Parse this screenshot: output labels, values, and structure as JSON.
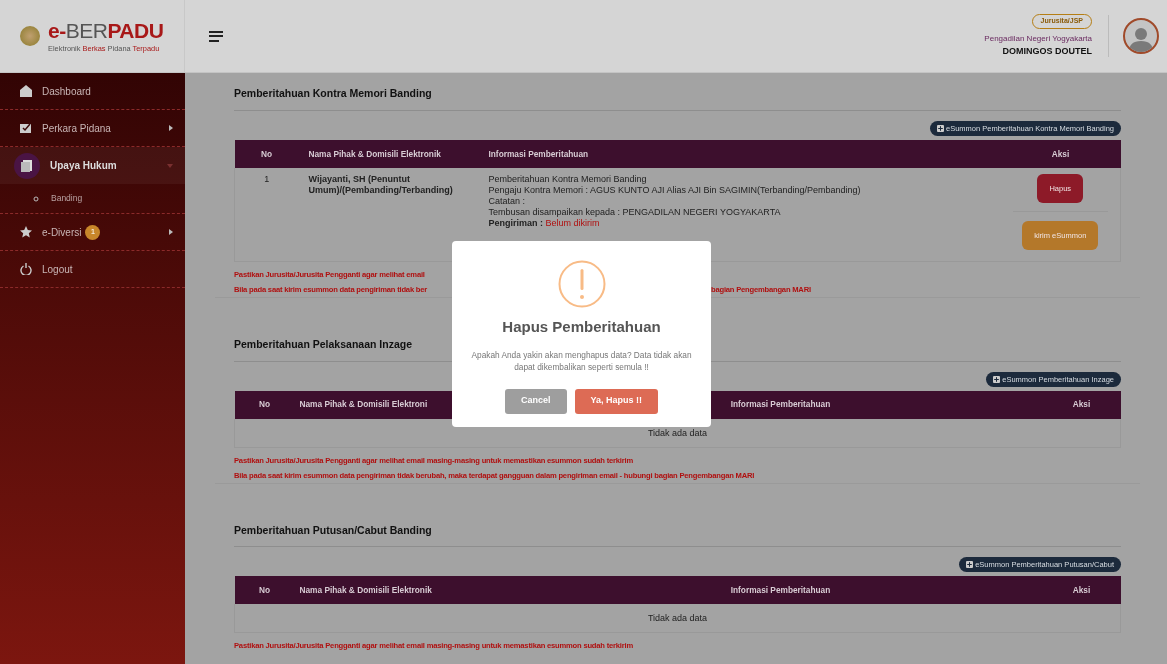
{
  "header": {
    "logo_parts": [
      {
        "text": "e-",
        "accent": true
      },
      {
        "text": "BER",
        "accent": false
      },
      {
        "text": "PADU",
        "accent": true
      }
    ],
    "tagline_parts": [
      {
        "text": "Elektronik",
        "accent": false
      },
      {
        "text": "Berkas",
        "accent": true
      },
      {
        "text": "Pidana",
        "accent": false
      },
      {
        "text": "Terpadu",
        "accent": true
      }
    ],
    "role_badge": "Jurusita/JSP",
    "court": "Pengadilan Negeri Yogyakarta",
    "user": "DOMINGOS DOUTEL"
  },
  "sidebar": {
    "items": [
      {
        "label": "Dashboard",
        "kind": "link",
        "selected": false
      },
      {
        "label": "Perkara Pidana",
        "kind": "menu",
        "selected": false,
        "expanded": false
      },
      {
        "label": "Upaya Hukum",
        "kind": "menu",
        "selected": true,
        "expanded": true,
        "children": [
          {
            "label": "Banding",
            "selected": false
          }
        ]
      },
      {
        "label": "e-Diversi",
        "kind": "menu",
        "selected": false,
        "expanded": false,
        "badge": "1"
      },
      {
        "label": "Logout",
        "kind": "link",
        "selected": false
      }
    ]
  },
  "sections": [
    {
      "title": "Pemberitahuan Kontra Memori Banding",
      "button": "eSummon Pemberitahuan Kontra Memori Banding",
      "columns": [
        "No",
        "Nama Pihak & Domisili Elektronik",
        "Informasi Pemberitahuan",
        "Aksi"
      ],
      "rows": [
        {
          "no": "1",
          "party": "Wijayanti, SH (Penuntut Umum)/(Pembanding/Terbanding)",
          "info_lines": [
            "Pemberitahuan Kontra Memori Banding",
            "Pengaju Kontra Memori : AGUS KUNTO AJI Alias AJI Bin SAGIMIN(Terbanding/Pembanding)",
            "Catatan :",
            "Tembusan disampaikan kepada : PENGADILAN NEGERI YOGYAKARTA"
          ],
          "delivery_label": "Pengiriman :",
          "delivery_status": "Belum dikirim",
          "actions": [
            {
              "label": "Hapus",
              "kind": "danger"
            },
            {
              "label": "kirim eSummon",
              "kind": "warning"
            }
          ]
        }
      ],
      "notes": [
        {
          "kind": "split",
          "left": "Pastikan Jurusita/Jurusita Pengganti agar melihat email"
        },
        {
          "kind": "split",
          "left": "Bila pada saat kirim esummon data pengiriman tidak ber",
          "right": "bagian Pengembangan MARI"
        }
      ]
    },
    {
      "title": "Pemberitahuan Pelaksanaan Inzage",
      "button": "eSummon Pemberitahuan Inzage",
      "columns": [
        "No",
        "Nama Pihak & Domisili Elektroni",
        "Informasi Pemberitahuan",
        "Aksi"
      ],
      "empty_text": "Tidak ada data",
      "notes": [
        {
          "kind": "full",
          "text": "Pastikan Jurusita/Jurusita Pengganti agar melihat email masing-masing untuk memastikan esummon sudah terkirim"
        },
        {
          "kind": "full",
          "text": "Bila pada saat kirim esummon data pengiriman tidak berubah, maka terdapat gangguan dalam pengiriman email - hubungi bagian Pengembangan MARI"
        }
      ]
    },
    {
      "title": "Pemberitahuan Putusan/Cabut Banding",
      "button": "eSummon Pemberitahuan Putusan/Cabut",
      "columns": [
        "No",
        "Nama Pihak & Domisili Elektronik",
        "Informasi Pemberitahuan",
        "Aksi"
      ],
      "empty_text": "Tidak ada data",
      "notes": [
        {
          "kind": "full",
          "text": "Pastikan Jurusita/Jurusita Pengganti agar melihat email masing-masing untuk memastikan esummon sudah terkirim"
        }
      ]
    }
  ],
  "dialog": {
    "title": "Hapus Pemberitahuan",
    "message": "Apakah Anda yakin akan menghapus data? Data tidak akan dapat dikembalikan seperti semula !!",
    "buttons": [
      {
        "label": "Cancel",
        "kind": "cancel"
      },
      {
        "label": "Ya, Hapus !!",
        "kind": "confirm"
      }
    ]
  }
}
